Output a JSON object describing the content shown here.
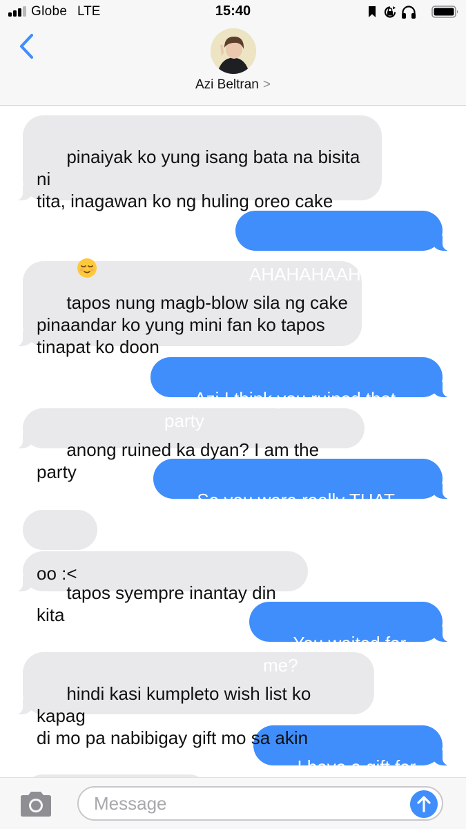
{
  "status_bar": {
    "carrier": "Globe",
    "network": "LTE",
    "time": "15:40"
  },
  "header": {
    "contact_name": "Azi Beltran",
    "contact_chevron": ">"
  },
  "messages": [
    {
      "from": "them",
      "text": "pinaiyak ko yung isang bata na bisita ni\ntita, inagawan ko ng huling oreo cake",
      "emoji": "relieved-face-emoji"
    },
    {
      "from": "me",
      "text": "AHAHAHAAHAHAHA"
    },
    {
      "from": "them",
      "text": "tapos nung magb-blow sila ng cake\npinaandar ko yung mini fan ko tapos\ntinapat ko doon"
    },
    {
      "from": "me",
      "text": "Azi I think you ruined that party"
    },
    {
      "from": "them",
      "text": "anong ruined ka dyan? I am the party"
    },
    {
      "from": "me",
      "text": "So you were really THAT bored"
    },
    {
      "from": "them",
      "text": "oo :<"
    },
    {
      "from": "them",
      "text": "tapos syempre inantay din kita"
    },
    {
      "from": "me",
      "text": "You waited for me?"
    },
    {
      "from": "them",
      "text": "hindi kasi kumpleto wish list ko kapag\ndi mo pa nabibigay gift mo sa akin"
    },
    {
      "from": "me",
      "text": "I have a gift for you"
    }
  ],
  "composer": {
    "placeholder": "Message",
    "value": ""
  },
  "colors": {
    "outgoing_bubble": "#3f8efc",
    "incoming_bubble": "#e9e9eb",
    "header_bg": "#f7f7f8"
  },
  "icons": [
    "back-chevron-icon",
    "camera-icon",
    "send-arrow-icon",
    "signal-icon",
    "bookmark-icon",
    "orientation-lock-icon",
    "headphones-icon",
    "battery-icon"
  ]
}
